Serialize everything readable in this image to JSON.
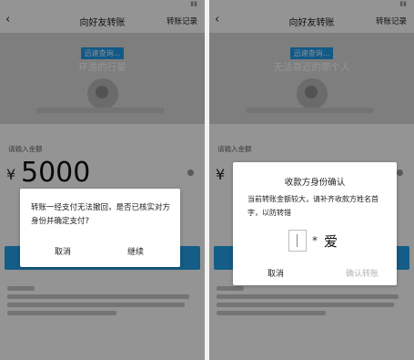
{
  "left_screen": {
    "nav": {
      "back_glyph": "‹",
      "title": "向好友转账",
      "record": "转账记录"
    },
    "payee": {
      "badge": "迅速查询...",
      "nickname": "环游的行星"
    },
    "amount": {
      "label": "请输入金额",
      "currency": "¥",
      "value": "5000"
    },
    "dialog": {
      "message": "转账一经支付无法撤回，是否已核实对方身份并确定支付?",
      "cancel": "取消",
      "continue": "继续"
    }
  },
  "right_screen": {
    "nav": {
      "back_glyph": "‹",
      "title": "向好友转账",
      "record": "转账记录"
    },
    "payee": {
      "badge": "迅速查询...",
      "nickname": "无法靠近的那个人"
    },
    "amount": {
      "label": "请输入金额",
      "currency": "¥"
    },
    "dialog": {
      "title": "收款方身份确认",
      "message": "当前转账金额较大，请补齐收款方姓名首字，以防转错",
      "masked_dot": "*",
      "given_name": "爱",
      "cancel": "取消",
      "confirm": "确认转账"
    }
  },
  "colors": {
    "accent": "#23a0e8",
    "overlay": "rgba(0,0,0,0.42)"
  }
}
